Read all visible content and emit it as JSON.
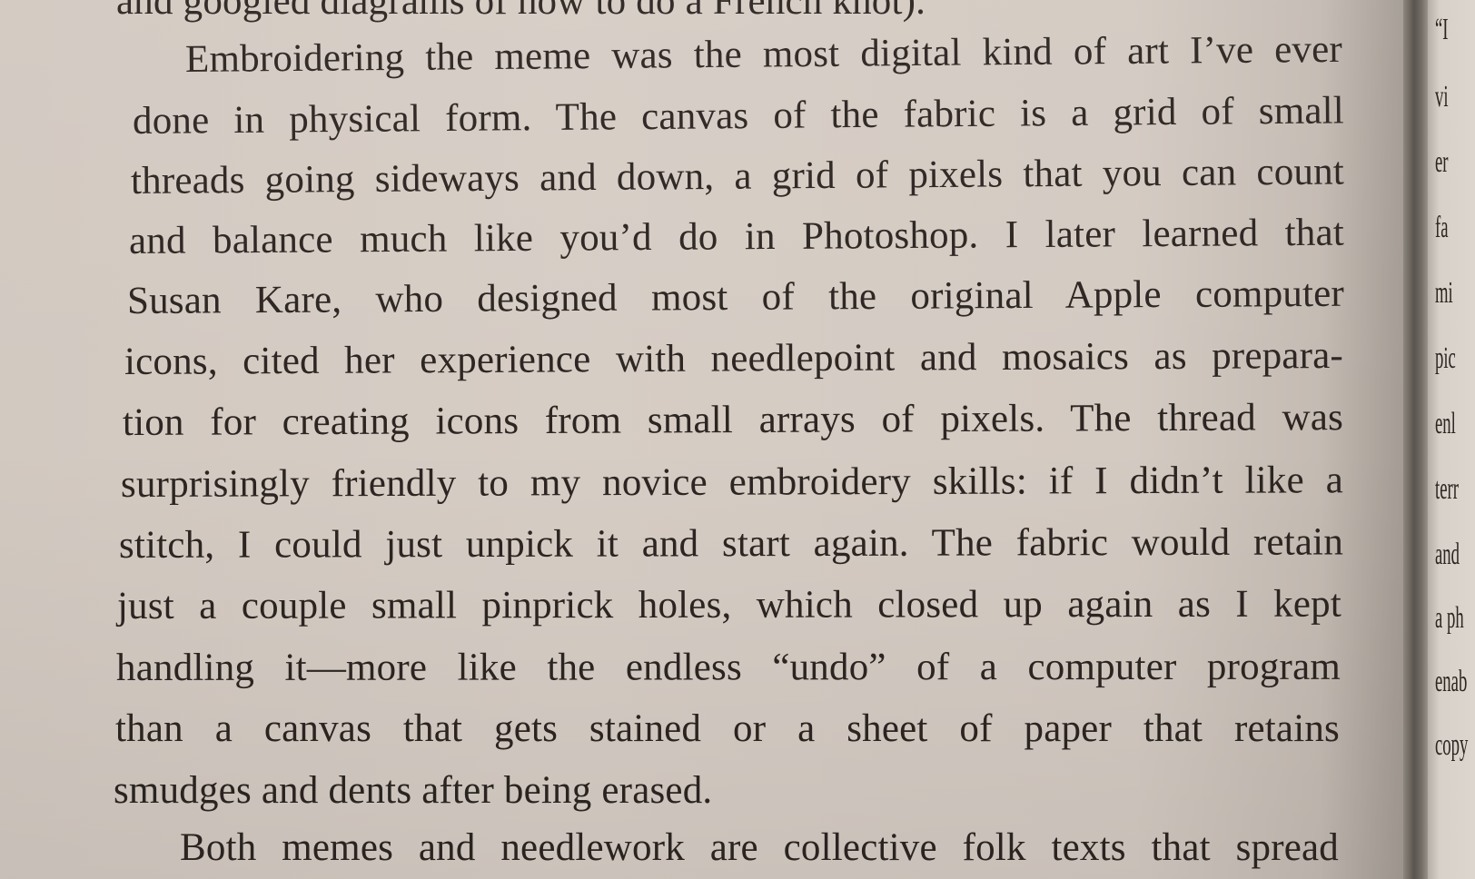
{
  "left_page": {
    "lines": [
      "and googled diagrams of how to do a French knot).",
      "Embroidering the meme was the most digital kind of art I’ve ever",
      "done in physical form. The canvas of the fabric is a grid of small",
      "threads going sideways and down, a grid of pixels that you can count",
      "and balance much like you’d do in Photoshop. I later learned that",
      "Susan Kare, who designed most of the original Apple computer",
      "icons, cited her experience with needlepoint and mosaics as prepara-",
      "tion for creating icons from small arrays of pixels. The thread was",
      "surprisingly friendly to my novice embroidery skills: if I didn’t like a",
      "stitch, I could just unpick it and start again. The fabric would retain",
      "just a couple small pinprick holes, which closed up again as I kept",
      "handling it—more like the endless “undo” of a computer program",
      "than a canvas that gets stained or a sheet of paper that retains",
      "smudges and dents after being erased.",
      "Both memes and needlework are collective folk texts that spread"
    ]
  },
  "right_page": {
    "fragments": [
      "“I",
      "vi",
      "er",
      "fa",
      "mi",
      "pic",
      "enl",
      "terr",
      "and",
      "a ph",
      "enab",
      "copy"
    ]
  }
}
